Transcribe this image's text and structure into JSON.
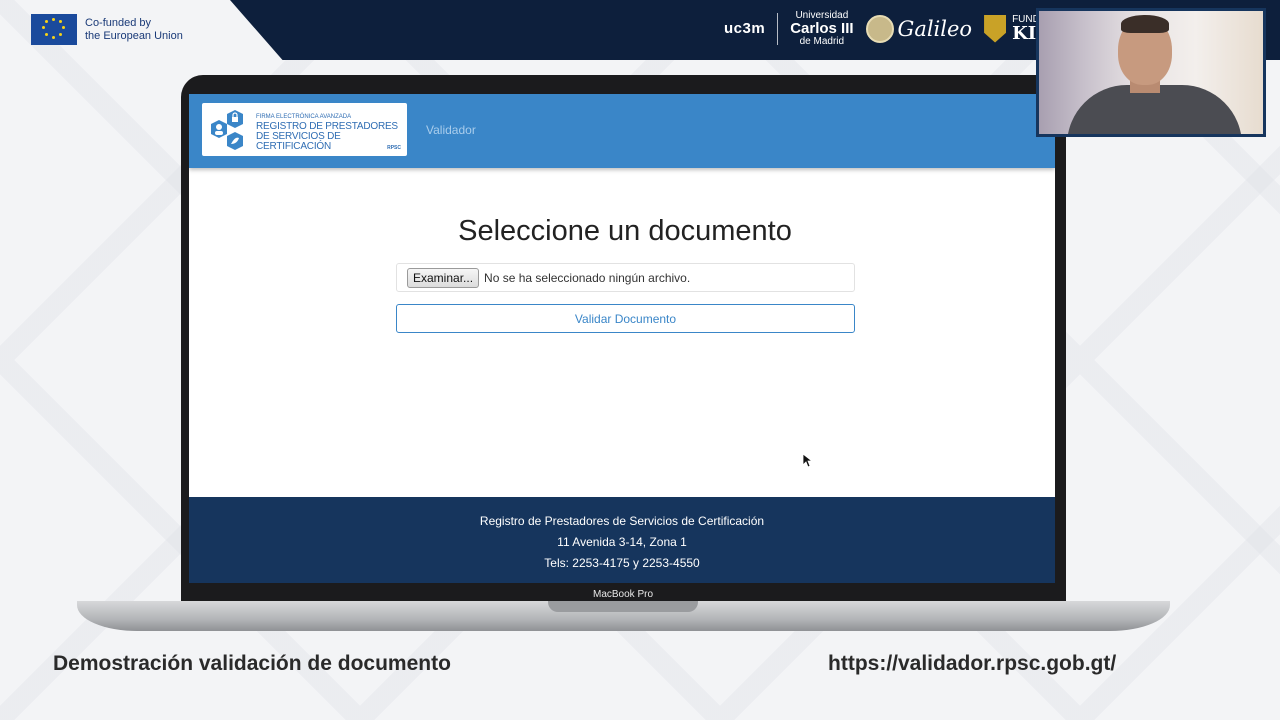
{
  "slide": {
    "eu_text_line1": "Co-funded by",
    "eu_text_line2": "the European Union",
    "sponsors": {
      "uc3m": "uc3m",
      "uc3m_line1": "Universidad",
      "uc3m_line2": "Carlos III",
      "uc3m_line3": "de Madrid",
      "galileo": "Galileo",
      "kinal_line1": "FUNDACIÓ",
      "kinal_line2": "KINAL"
    },
    "caption_left": "Demostración validación de documento",
    "caption_right": "https://validador.rpsc.gob.gt/",
    "device_label": "MacBook Pro"
  },
  "site": {
    "logo": {
      "small": "FIRMA ELECTRÓNICA AVANZADA",
      "line1": "REGISTRO DE PRESTADORES",
      "line2": "DE SERVICIOS DE CERTIFICACIÓN",
      "abbr": "RPSC"
    },
    "nav_link": "Validador",
    "heading": "Seleccione un documento",
    "browse_button": "Examinar...",
    "file_status": "No se ha seleccionado ningún archivo.",
    "validate_button": "Validar Documento",
    "footer": {
      "line1": "Registro de Prestadores de Servicios de Certificación",
      "line2": "11 Avenida 3-14, Zona 1",
      "line3": "Tels: 2253-4175 y 2253-4550"
    }
  },
  "colors": {
    "nav_blue": "#3a86c8",
    "footer_navy": "#16355d",
    "banner_navy": "#0d1f3c"
  }
}
